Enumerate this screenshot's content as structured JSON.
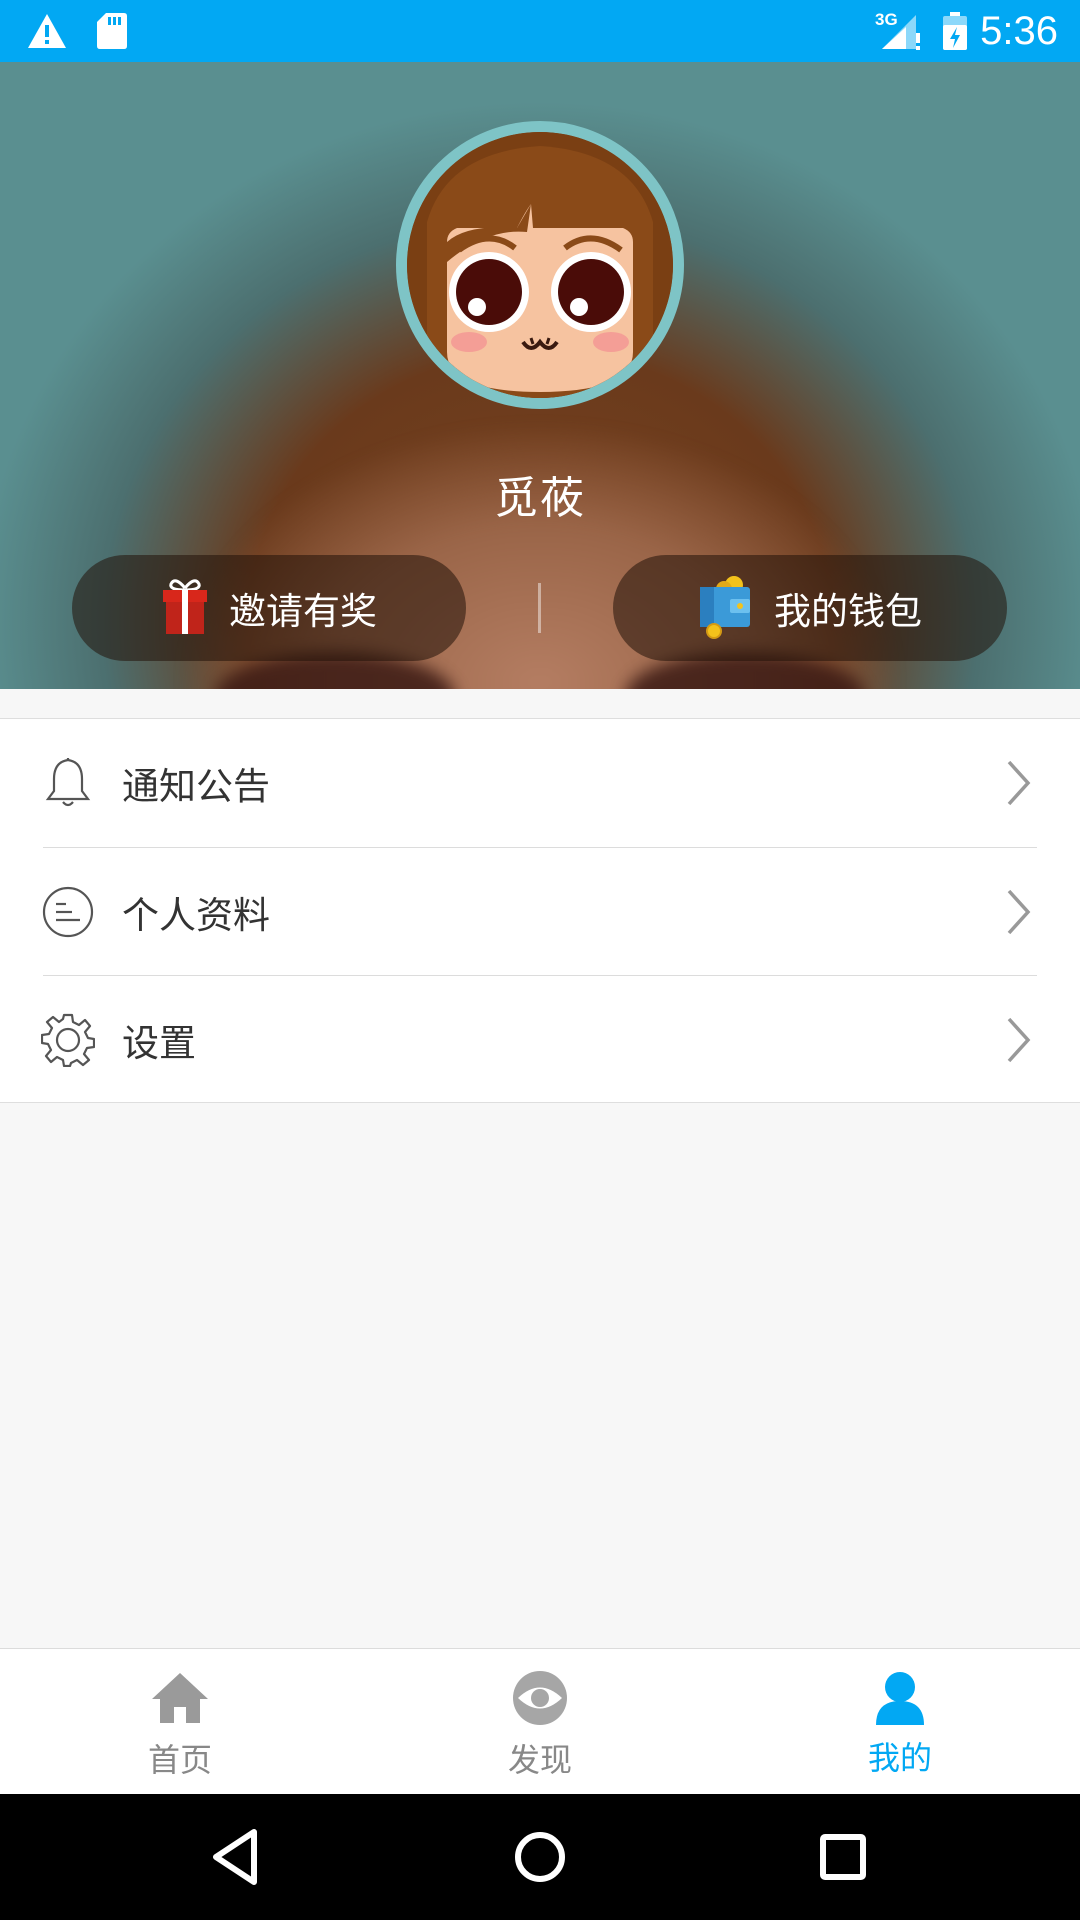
{
  "status_bar": {
    "time": "5:36",
    "network": "3G",
    "left_icons": [
      "warning-icon",
      "sd-card-icon"
    ],
    "right_icons": [
      "signal-icon",
      "battery-charging-icon"
    ],
    "background_color": "#02a8f3"
  },
  "profile": {
    "nickname": "觅莜",
    "avatar": "cartoon-girl-avatar"
  },
  "actions": {
    "invite": {
      "label": "邀请有奖",
      "icon": "gift-icon"
    },
    "wallet": {
      "label": "我的钱包",
      "icon": "wallet-icon"
    }
  },
  "menu": {
    "items": [
      {
        "label": "通知公告",
        "icon": "bell-icon"
      },
      {
        "label": "个人资料",
        "icon": "profile-list-icon"
      },
      {
        "label": "设置",
        "icon": "gear-icon"
      }
    ]
  },
  "bottom_nav": {
    "tabs": [
      {
        "label": "首页",
        "icon": "home-icon",
        "active": false
      },
      {
        "label": "发现",
        "icon": "eye-icon",
        "active": false
      },
      {
        "label": "我的",
        "icon": "person-icon",
        "active": true
      }
    ],
    "active_color": "#02a8f3",
    "inactive_color": "#888888"
  },
  "system_nav": {
    "buttons": [
      "back-icon",
      "home-circle-icon",
      "recents-icon"
    ]
  }
}
